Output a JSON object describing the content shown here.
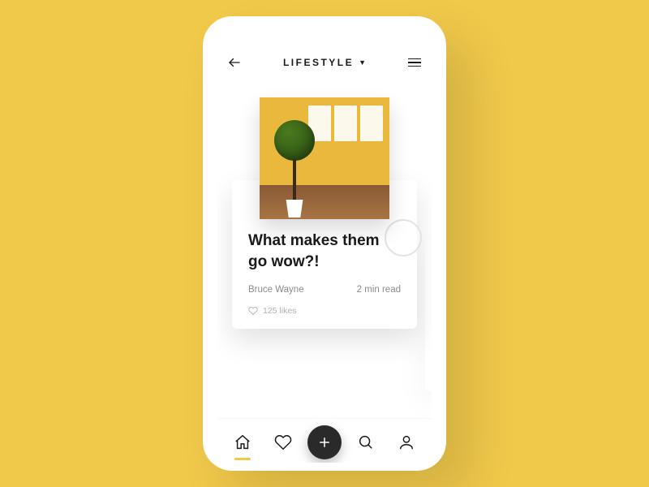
{
  "header": {
    "title": "LIFESTYLE"
  },
  "article": {
    "title": "What makes them go wow?!",
    "author": "Bruce Wayne",
    "read_time": "2 min read",
    "likes_label": "125 likes"
  },
  "nav": {
    "home": "Home",
    "favorites": "Favorites",
    "add": "Add",
    "search": "Search",
    "profile": "Profile"
  }
}
